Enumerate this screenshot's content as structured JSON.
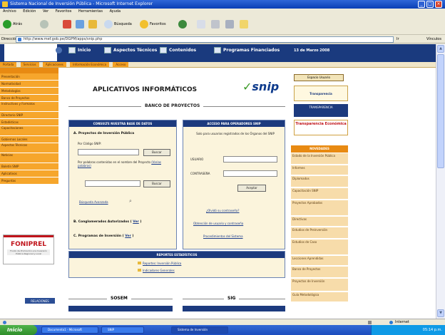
{
  "window": {
    "title": "Sistema Nacional de Inversión Pública - Microsoft Internet Explorer"
  },
  "menu": [
    "Archivo",
    "Edición",
    "Ver",
    "Favoritos",
    "Herramientas",
    "Ayuda"
  ],
  "toolbar": {
    "back_label": "Atrás",
    "search_label": "Búsqueda",
    "favorites_label": "Favoritos"
  },
  "address": {
    "label": "Dirección",
    "url": "http://www.mef.gob.pe/DGPM/apps/snip.php",
    "go_label": "Ir",
    "links_label": "Vínculos"
  },
  "site_nav": {
    "items": [
      "Inicio",
      "Aspectos Técnicos",
      "Contenidos",
      "Programas Financiados"
    ],
    "date": "13 de Marzo 2008"
  },
  "breadcrumbs": [
    "Portada",
    "Servicios",
    "Aplicaciones",
    "Información Económica",
    "Acceso"
  ],
  "left_menu": [
    "Presentación",
    "Normatividad",
    "Metodologías",
    "Banco de Proyectos",
    "Instructivos y Formatos",
    "Directorio SNIP",
    "Estadísticas",
    "Capacitaciones",
    "Gobiernos Locales",
    "Aspectos Técnicos",
    "Noticias",
    "Boletín SNIP",
    "Aplicativos",
    "Preguntas"
  ],
  "foniprel": {
    "title": "FONIPREL",
    "subtitle": "Fondo de Promoción a la Inversión Pública Regional y Local"
  },
  "left_button": "RELACIONES",
  "main": {
    "title": "APLICATIVOS INFORMÁTICOS",
    "logo": "snip",
    "banco_title": "BANCO DE PROYECTOS",
    "consult": {
      "header": "CONSULTE NUESTRA BASE DE DATOS",
      "section_a": "A. Proyectos de Inversión Pública",
      "code_label": "Por Código SNIP:",
      "search_button": "Buscar",
      "keywords_label": "Por palabras contenidas en el nombre del Proyecto",
      "keywords_link": "(Varias palabras)",
      "advanced_link": "Búsqueda Avanzada",
      "section_b": "B. Conglomerados Autorizados",
      "section_b_link": "Ver",
      "section_c": "C. Programas de Inversión",
      "section_c_link": "Ver"
    },
    "access": {
      "header": "ACCESO PARA OPERADORES SNIP",
      "intro": "Solo para usuarios registrados de los Órganos del SNIP",
      "user_label": "USUARIO",
      "password_label": "CONTRASEÑA",
      "accept_button": "Aceptar",
      "forgot_link": "¿Olvidó su contraseña?",
      "obtain_link": "Obtención de usuario y contraseña",
      "procedures_link": "Procedimientos del Sistema"
    },
    "reports": {
      "header": "REPORTES ESTADÍSTICOS",
      "link1": "Reportes: Inversión Pública",
      "link2": "Indicadores Generales"
    },
    "sosem": "SOSEM",
    "sig": "SIG"
  },
  "right_sidebar": {
    "buttons": [
      "Espacio Usuario"
    ],
    "transparencia1": "Transparencia",
    "transparencia2": "TRANSPARENCIA",
    "transparencia3": "Transparencia Económica",
    "news_header": "NOVEDADES",
    "items": [
      "Estado de la Inversión Pública",
      "Informes",
      "Diplomados",
      "Capacitación SNIP",
      "Proyectos Aprobados",
      "Directivas",
      "Estudios de Preinversión",
      "Estudios de Caso",
      "Lecciones Aprendidas",
      "Banco de Proyectos",
      "Proyectos de Inversión",
      "Guía Metodológica"
    ]
  },
  "statusbar": {
    "zone": "Internet"
  },
  "taskbar": {
    "start": "Inicio",
    "tasks": [
      "Documento1 - Microsoft",
      "SNIP",
      "Sistema de Inversión"
    ],
    "clock": "05:14 p.m."
  }
}
